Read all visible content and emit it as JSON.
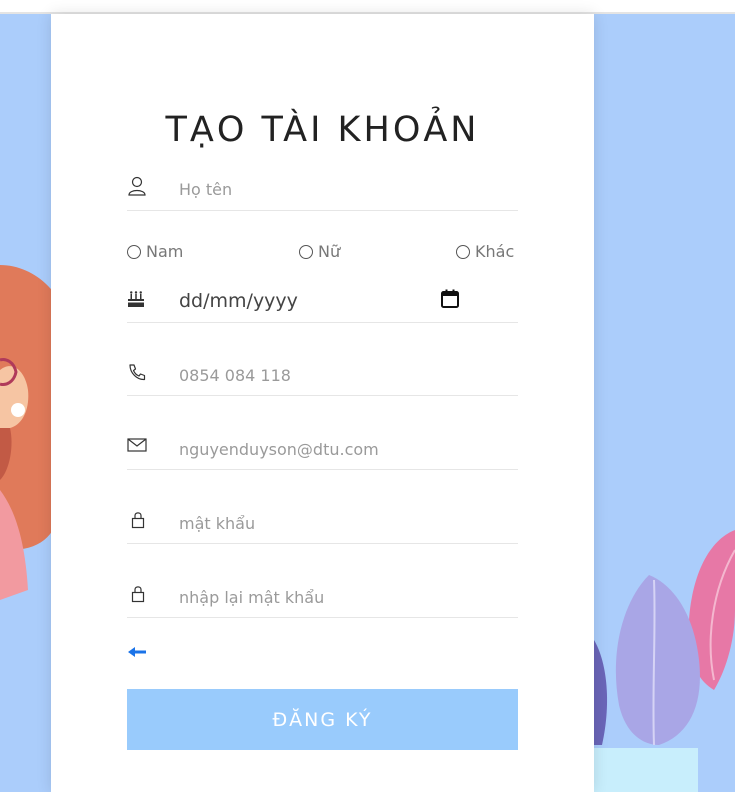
{
  "form": {
    "title": "TẠO TÀI KHOẢN",
    "name_placeholder": "Họ tên",
    "gender_options": [
      "Nam",
      "Nữ",
      "Khác"
    ],
    "dob_placeholder": "dd/mm/yyyy",
    "phone_placeholder": "0854 084 118",
    "email_placeholder": "nguyenduyson@dtu.com",
    "password_placeholder": "mật khẩu",
    "confirm_password_placeholder": "nhập lại mật khẩu",
    "submit_label": "ĐĂNG KÝ"
  },
  "icons": {
    "name": "user-icon",
    "dob": "cake-icon",
    "calendar": "calendar-icon",
    "phone": "phone-icon",
    "email": "mail-icon",
    "password": "lock-icon",
    "back": "arrow-left-icon"
  },
  "colors": {
    "background": "#abcdfb",
    "button": "#99cbfc",
    "back_arrow": "#1a73e8",
    "girl_hair": "#e07a5a",
    "leaf_purple": "#a9a6e6",
    "leaf_pink": "#e778a6"
  }
}
